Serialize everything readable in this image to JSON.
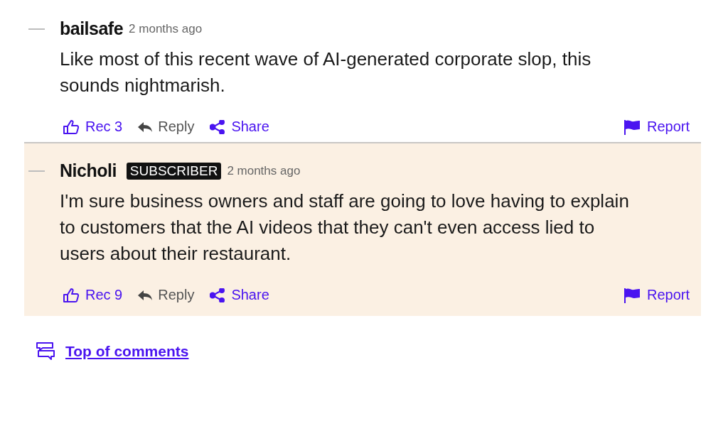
{
  "comments": [
    {
      "author": "bailsafe",
      "subscriber": false,
      "highlighted": false,
      "time": "2 months ago",
      "body": "Like most of this recent wave of AI-generated corporate slop, this sounds nightmarish.",
      "rec": "Rec 3",
      "reply": "Reply",
      "share": "Share",
      "report": "Report"
    },
    {
      "author": "Nicholi",
      "subscriber": true,
      "badge": "SUBSCRIBER",
      "highlighted": true,
      "time": "2 months ago",
      "body": "I'm sure business owners and staff are going to love having to explain to customers that the AI videos that they can't even access lied to users about their restaurant.",
      "rec": "Rec 9",
      "reply": "Reply",
      "share": "Share",
      "report": "Report"
    }
  ],
  "top_link": "Top of comments"
}
